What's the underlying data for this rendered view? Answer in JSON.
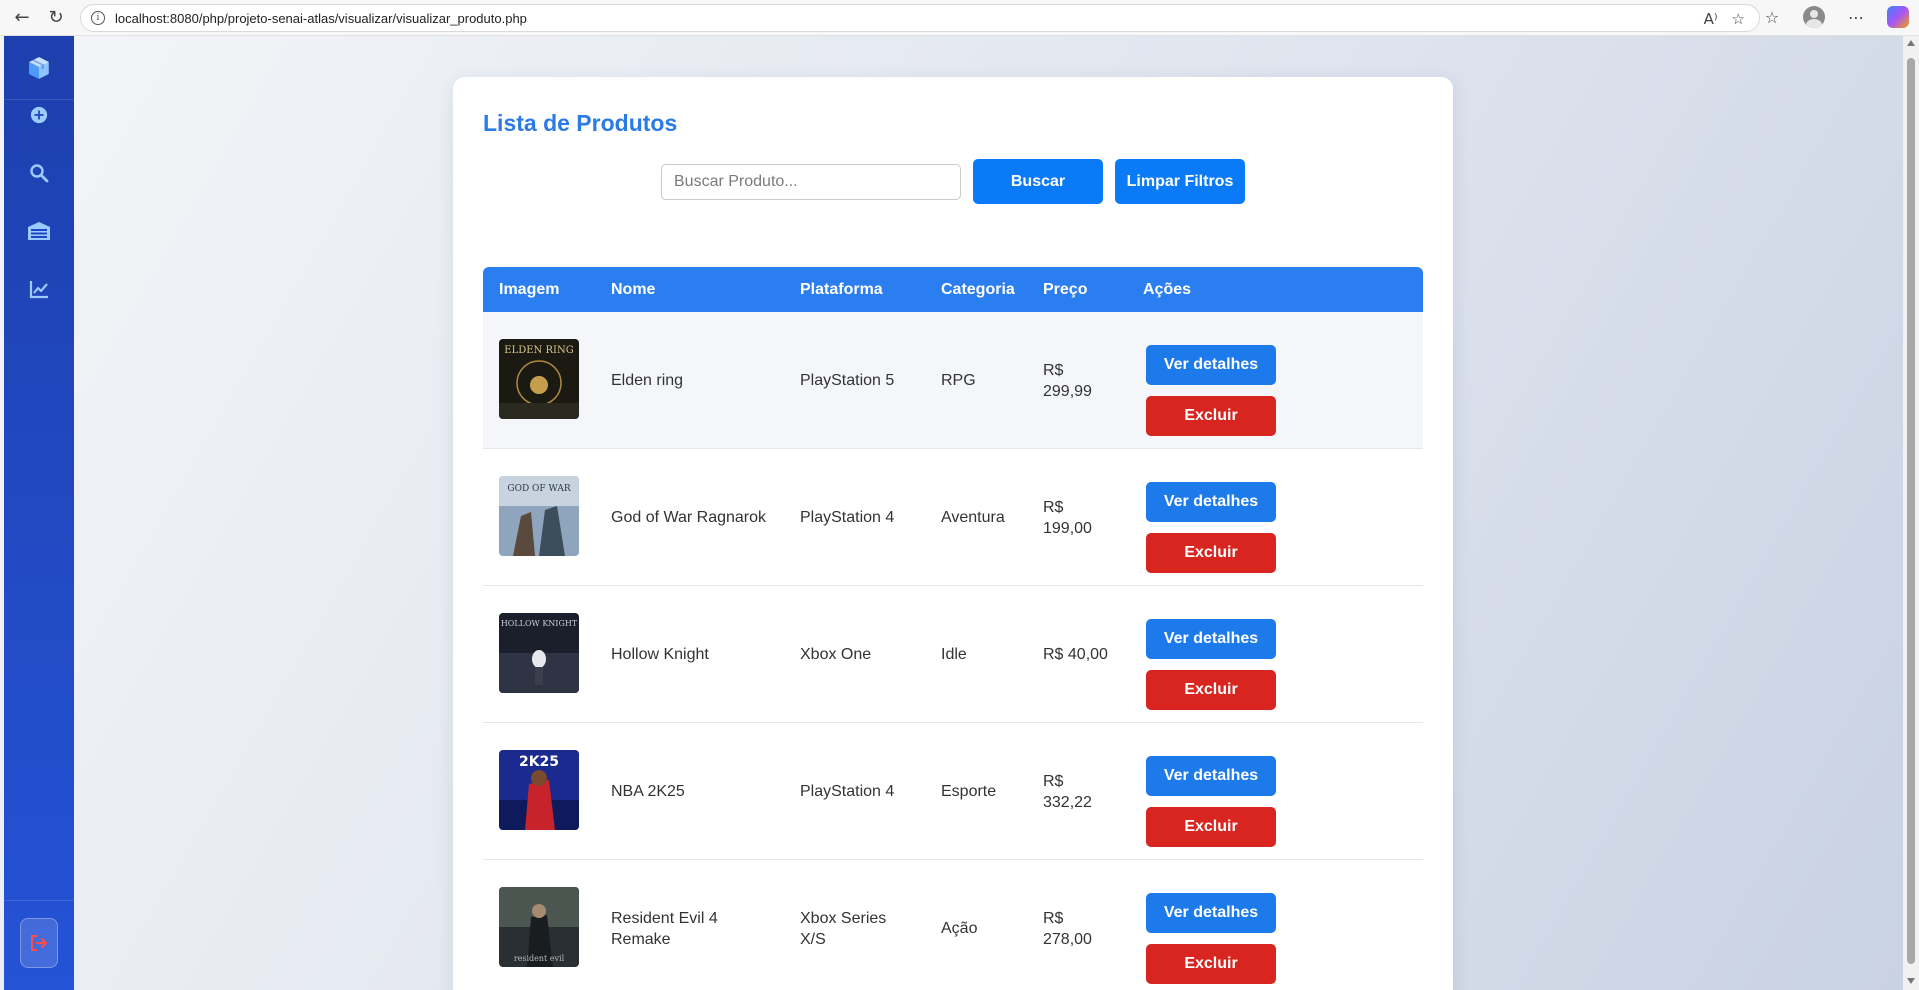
{
  "browser": {
    "url": "localhost:8080/php/projeto-senai-atlas/visualizar/visualizar_produto.php"
  },
  "page": {
    "title": "Lista de Produtos",
    "search": {
      "placeholder": "Buscar Produto...",
      "button_label": "Buscar",
      "clear_label": "Limpar Filtros"
    },
    "table": {
      "headers": [
        "Imagem",
        "Nome",
        "Plataforma",
        "Categoria",
        "Preço",
        "Ações"
      ],
      "rows": [
        {
          "nome": "Elden ring",
          "plataforma": "PlayStation 5",
          "categoria": "RPG",
          "preco": "R$ 299,99",
          "detalhes": "Ver detalhes",
          "excluir": "Excluir",
          "thumb_colors": [
            "#1c1a14",
            "#d2a44a"
          ]
        },
        {
          "nome": "God of War Ragnarok",
          "plataforma": "PlayStation 4",
          "categoria": "Aventura",
          "preco": "R$ 199,00",
          "detalhes": "Ver detalhes",
          "excluir": "Excluir",
          "thumb_colors": [
            "#5b7a9c",
            "#c7d3de"
          ]
        },
        {
          "nome": "Hollow Knight",
          "plataforma": "Xbox One",
          "categoria": "Idle",
          "preco": "R$ 40,00",
          "detalhes": "Ver detalhes",
          "excluir": "Excluir",
          "thumb_colors": [
            "#1a1f2b",
            "#8d93a4"
          ]
        },
        {
          "nome": "NBA 2K25",
          "plataforma": "PlayStation 4",
          "categoria": "Esporte",
          "preco": "R$ 332,22",
          "detalhes": "Ver detalhes",
          "excluir": "Excluir",
          "thumb_colors": [
            "#1b2a8f",
            "#c8232b"
          ]
        },
        {
          "nome": "Resident Evil 4 Remake",
          "plataforma": "Xbox Series X/S",
          "categoria": "Ação",
          "preco": "R$ 278,00",
          "detalhes": "Ver detalhes",
          "excluir": "Excluir",
          "thumb_colors": [
            "#2a2f33",
            "#7d8a7a"
          ]
        }
      ]
    }
  },
  "sidebar": {
    "items": [
      {
        "icon": "cube-icon"
      },
      {
        "icon": "plus-circle-icon"
      },
      {
        "icon": "search-icon"
      },
      {
        "icon": "warehouse-icon"
      },
      {
        "icon": "chart-line-icon"
      },
      {
        "icon": "logout-icon"
      }
    ]
  },
  "colors": {
    "primary": "#2b7be6",
    "button_blue": "#0a7af7",
    "danger": "#d9251f",
    "sidebar_top": "#1e3fae",
    "sidebar_bottom": "#2453d6"
  }
}
